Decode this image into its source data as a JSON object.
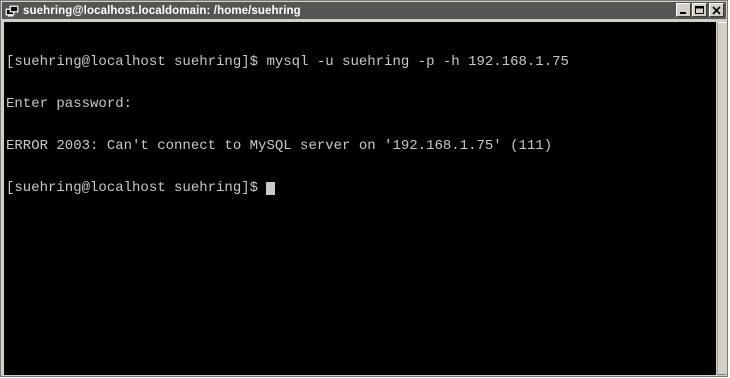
{
  "window": {
    "title": "suehring@localhost.localdomain: /home/suehring",
    "icons": {
      "app": "putty-terminal-icon",
      "minimize": "minimize-icon",
      "maximize": "maximize-icon",
      "close": "close-icon"
    }
  },
  "terminal": {
    "lines": [
      "[suehring@localhost suehring]$ mysql -u suehring -p -h 192.168.1.75",
      "Enter password:",
      "ERROR 2003: Can't connect to MySQL server on '192.168.1.75' (111)"
    ],
    "prompt": "[suehring@localhost suehring]$ "
  },
  "colors": {
    "terminal_bg": "#000000",
    "terminal_fg": "#c8c8c8",
    "titlebar_bg": "#555555",
    "frame": "#d4d0c8"
  }
}
